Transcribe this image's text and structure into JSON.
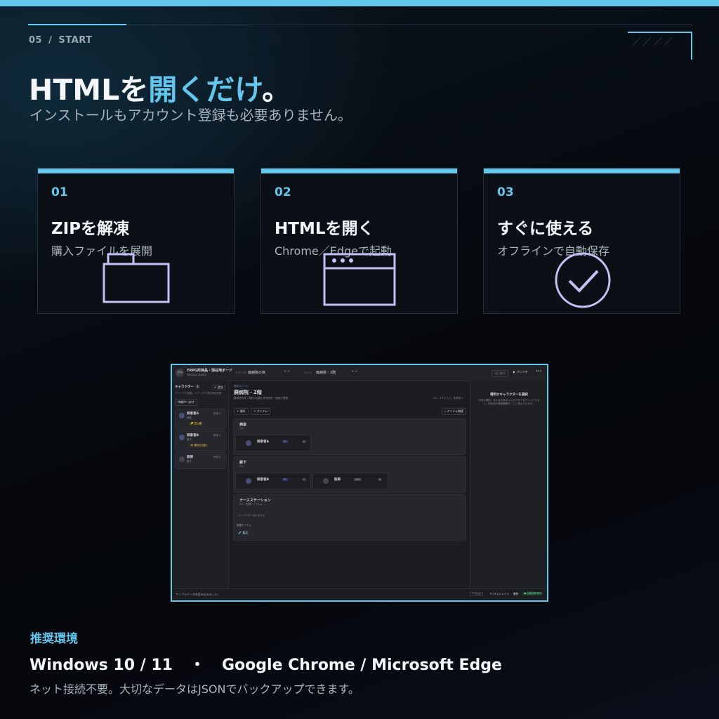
{
  "header": {
    "section_number": "05",
    "section_sep": "/",
    "section_name": "START",
    "corner_marks": "／／／／",
    "title_prefix": "HTMLを",
    "title_accent": "開くだけ",
    "title_suffix": "。",
    "subtitle": "インストールもアカウント登録も必要ありません。"
  },
  "steps": [
    {
      "number": "01",
      "title": "ZIPを解凍",
      "description": "購入ファイルを展開",
      "icon": "folder-icon"
    },
    {
      "number": "02",
      "title": "HTMLを開く",
      "description": "Chrome／Edgeで起動",
      "icon": "browser-window-icon"
    },
    {
      "number": "03",
      "title": "すぐに使える",
      "description": "オフラインで自動保存",
      "icon": "check-circle-icon"
    }
  ],
  "screenshot": {
    "logo": "ITM",
    "app_title": "TRPG所持品・現在地ボード",
    "app_subtitle": "Session board",
    "scenario_label": "シナリオ",
    "scenario_value": "廃病院の夜",
    "scene_label": "シーン",
    "scene_value": "廃病院・2階",
    "undo_top": "元に戻す",
    "play_button": "▶ プレイ中",
    "more": "•••",
    "sidebar": {
      "title": "キャラクター",
      "count": "3",
      "add": "+ 追加",
      "hint": "クリックで詳細、ドラッグで現在地を変更",
      "to_waiting": "待機中へ戻す",
      "characters": [
        {
          "initial": "A",
          "name": "探索者A",
          "location": "病室",
          "tag": "所持 2",
          "item": "🔑 古い鍵"
        },
        {
          "initial": "B",
          "name": "探索者B",
          "location": "廊下",
          "tag": "所持 1",
          "item": "📼 壊れた日記"
        },
        {
          "initial": "N",
          "name": "医師",
          "location": "廊下",
          "tag": "所持 0",
          "item": ""
        }
      ]
    },
    "main": {
      "eyebrow": "現在のシーン",
      "scene_title": "廃病院・2階",
      "scene_desc": "廃病院の夜｜現在の位置と所持品を一画面で管理",
      "stats": "3人　4アイテム　未使用 1",
      "add_place": "+ 場所",
      "add_item": "+ アイテム",
      "search_item": "⌕ アイテム検索",
      "places": [
        {
          "name": "病室",
          "sub": "1人",
          "members": [
            {
              "initial": "A",
              "name": "探索者A",
              "badge": "PC",
              "count": "2"
            }
          ]
        },
        {
          "name": "廊下",
          "sub": "2人",
          "members": [
            {
              "initial": "B",
              "name": "探索者B",
              "badge": "PC",
              "count": "1"
            },
            {
              "initial": "N",
              "name": "医師",
              "badge": "NPC",
              "count": "0"
            }
          ]
        },
        {
          "name": "ナースステーション",
          "sub": "0人・配置アイテム1",
          "empty": "キャラクターはいません",
          "items_label": "配置アイテム",
          "item": "🧪 薬品"
        }
      ]
    },
    "right_panel": {
      "title": "場所かキャラクターを選択",
      "body": "中央の場所、または左側のキャラクターをクリックすると、所持品や移動履歴がここに表示されます。"
    },
    "footer": {
      "status": "サンプルデータを読み込みました。",
      "undo": "↶ Undo",
      "item_tray": "アイテムトレイ 2",
      "history": "履歴",
      "saved": "● 自動保存済み"
    }
  },
  "recommended": {
    "label": "推奨環境",
    "os": "Windows 10 / 11",
    "separator": "・",
    "browsers": "Google Chrome / Microsoft Edge",
    "note": "ネット接続不要。大切なデータはJSONでバックアップできます。"
  },
  "colors": {
    "accent": "#63c6ec",
    "icon": "#c4bff4",
    "background": "#06090e"
  }
}
